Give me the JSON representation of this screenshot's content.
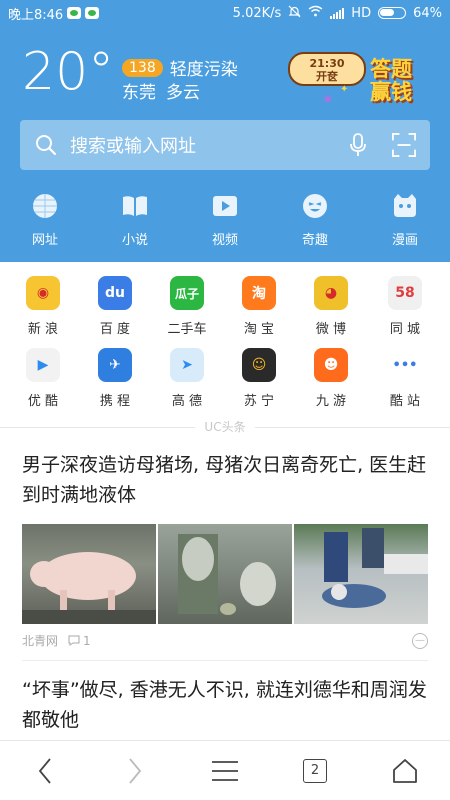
{
  "status_bar": {
    "time": "晚上8:46",
    "speed": "5.02K/s",
    "network": "HD",
    "battery": "64%",
    "battery_level": 0.64
  },
  "weather": {
    "temperature": "20°",
    "aqi_value": "138",
    "aqi_text": "轻度污染",
    "city": "东莞",
    "condition": "多云"
  },
  "promo": {
    "time": "21:30",
    "subtitle": "开奁",
    "title": "答题赢钱"
  },
  "search": {
    "placeholder": "搜索或输入网址"
  },
  "quick_links": [
    {
      "label": "网址",
      "icon": "globe-icon"
    },
    {
      "label": "小说",
      "icon": "book-icon"
    },
    {
      "label": "视频",
      "icon": "play-icon"
    },
    {
      "label": "奇趣",
      "icon": "funny-face-icon"
    },
    {
      "label": "漫画",
      "icon": "comic-icon"
    }
  ],
  "apps": [
    {
      "label": "新 浪",
      "icon": "sina-icon",
      "glyph": "◉",
      "color": "#f7c531"
    },
    {
      "label": "百 度",
      "icon": "baidu-icon",
      "glyph": "du",
      "color": "#3a7de6"
    },
    {
      "label": "二手车",
      "icon": "guazi-icon",
      "glyph": "瓜子",
      "color": "#2cb742"
    },
    {
      "label": "淘 宝",
      "icon": "taobao-icon",
      "glyph": "淘",
      "color": "#ff7a1c"
    },
    {
      "label": "微 博",
      "icon": "weibo-icon",
      "glyph": "◕",
      "color": "#f0c02a"
    },
    {
      "label": "同 城",
      "icon": "58-icon",
      "glyph": "58",
      "color": "#f0f0f0"
    },
    {
      "label": "优 酷",
      "icon": "youku-icon",
      "glyph": "▶",
      "color": "#f2f2f2"
    },
    {
      "label": "携 程",
      "icon": "ctrip-icon",
      "glyph": "✈",
      "color": "#2f7fe0"
    },
    {
      "label": "高 德",
      "icon": "amap-icon",
      "glyph": "➤",
      "color": "#d7ebfa"
    },
    {
      "label": "苏 宁",
      "icon": "suning-icon",
      "glyph": "☺",
      "color": "#2a2a2a"
    },
    {
      "label": "九 游",
      "icon": "jiuyou-icon",
      "glyph": "☻",
      "color": "#ff6b1c"
    },
    {
      "label": "酷 站",
      "icon": "more-dots-icon",
      "glyph": "•••",
      "color": "#ffffff"
    }
  ],
  "feed_label": "UC头条",
  "news": [
    {
      "headline": "男子深夜造访母猪场, 母猪次日离奇死亡, 医生赶到时满地液体",
      "source": "北青网",
      "comments": "1"
    },
    {
      "headline": "“坏事”做尽, 香港无人不识, 就连刘德华和周润发都敬他"
    }
  ],
  "bottom_bar": {
    "tab_count": "2"
  }
}
